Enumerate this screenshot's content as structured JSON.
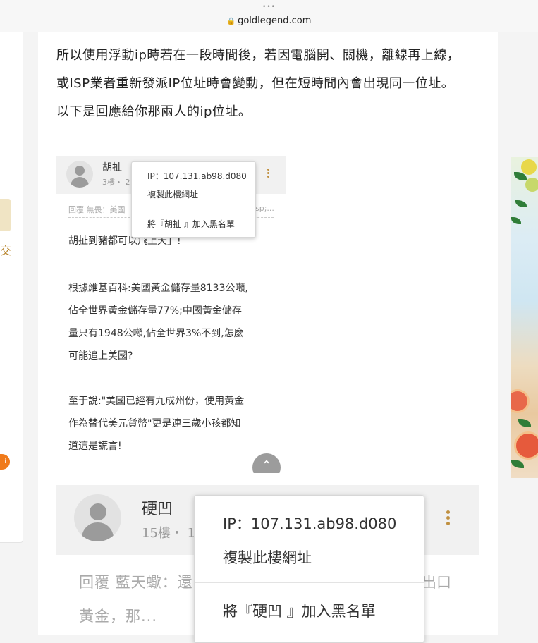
{
  "browser": {
    "dots": "•••",
    "url": "goldlegend.com"
  },
  "left_panel": {
    "partial_char": "交",
    "badge_partial": "i"
  },
  "article": {
    "lines": [
      "所以使用浮動ip時若在一段時間後，若因電腦開、關機，離線再上線，",
      "或ISP業者重新發派IP位址時會變動，但在短時間內會出現同一位址。",
      "以下是回應給你那兩人的ip位址。"
    ]
  },
  "comment1": {
    "name": "胡扯",
    "meta": "3樓・ 2",
    "reply_prefix": "回覆 無畏：美國",
    "reply_tail": "sp;...",
    "first_line_partial": "胡扯到豬都可以飛上天」!",
    "body_lines": [
      "根據維基百科:美國黃金儲存量8133公噸,",
      "佔全世界黃金儲存量77%;中國黃金儲存",
      "量只有1948公噸,佔全世界3%不到,怎麼",
      "可能追上美國?",
      "",
      "至于說:\"美國已經有九成州份，使用黃金",
      "作為替代美元貨幣\"更是連三歲小孩都知",
      "道這是謊言!"
    ],
    "scroll_up_icon": "⌃",
    "menu": {
      "ip": "IP：107.131.ab98.d080",
      "copy": "複製此樓網址",
      "blacklist": "將『胡扯 』加入黑名單"
    }
  },
  "comment2": {
    "name": "硬凹",
    "meta": "15樓・ 1",
    "reply_line1": "回覆 藍天蠍：還",
    "reply_line1_tail": "出口",
    "reply_line2": "黃金，那...",
    "menu": {
      "ip": "IP：107.131.ab98.d080",
      "copy": "複製此樓網址",
      "blacklist": "將『硬凹 』加入黑名單"
    }
  },
  "colors": {
    "accent_gold": "#c09040",
    "badge_orange": "#f07a1a",
    "header_gray": "#f1f1f1"
  }
}
